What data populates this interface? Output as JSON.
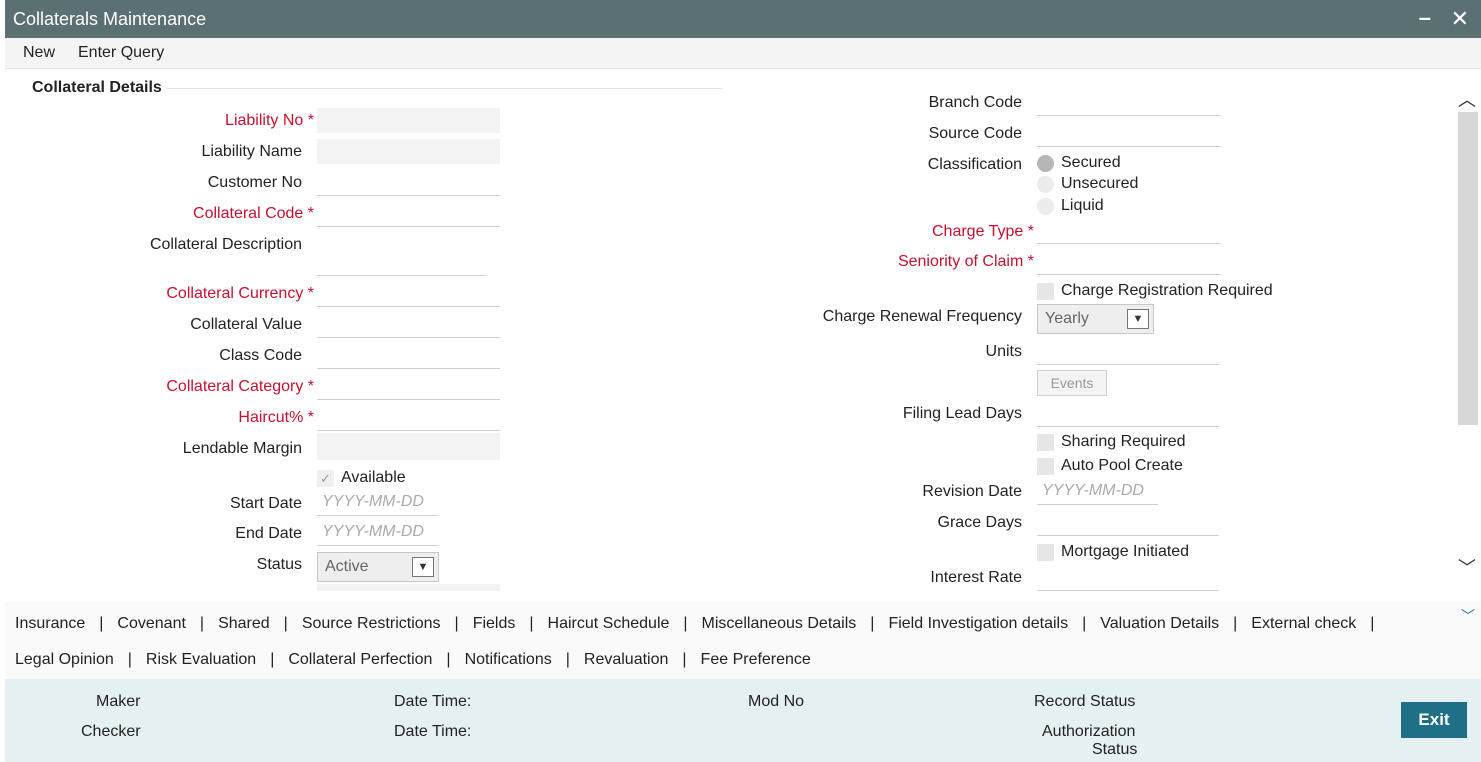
{
  "window": {
    "title": "Collaterals Maintenance",
    "minimize": "–",
    "close": "✕"
  },
  "menu": {
    "new": "New",
    "enter_query": "Enter Query"
  },
  "section": {
    "title": "Collateral Details"
  },
  "left": {
    "liability_no": "Liability No",
    "liability_name": "Liability Name",
    "customer_no": "Customer No",
    "collateral_code": "Collateral Code",
    "collateral_description": "Collateral Description",
    "collateral_currency": "Collateral Currency",
    "collateral_value": "Collateral Value",
    "class_code": "Class Code",
    "collateral_category": "Collateral Category",
    "haircut": "Haircut%",
    "lendable_margin": "Lendable Margin",
    "available": "Available",
    "start_date": "Start Date",
    "start_date_placeholder": "YYYY-MM-DD",
    "end_date": "End Date",
    "end_date_placeholder": "YYYY-MM-DD",
    "status": "Status",
    "status_value": "Active",
    "required_mark": "*"
  },
  "right": {
    "branch_code": "Branch Code",
    "source_code": "Source Code",
    "classification": "Classification",
    "classification_options": [
      "Secured",
      "Unsecured",
      "Liquid"
    ],
    "charge_type": "Charge Type",
    "seniority_of_claim": "Seniority of Claim",
    "charge_registration_required": "Charge Registration Required",
    "charge_renewal_frequency": "Charge Renewal Frequency",
    "charge_renewal_frequency_value": "Yearly",
    "units": "Units",
    "events_button": "Events",
    "filing_lead_days": "Filing Lead Days",
    "sharing_required": "Sharing Required",
    "auto_pool_create": "Auto Pool Create",
    "revision_date": "Revision Date",
    "revision_date_placeholder": "YYYY-MM-DD",
    "grace_days": "Grace Days",
    "mortgage_initiated": "Mortgage Initiated",
    "interest_rate": "Interest Rate",
    "required_mark": "*"
  },
  "tabs": {
    "row1": [
      "Insurance",
      "Covenant",
      "Shared",
      "Source Restrictions",
      "Fields",
      "Haircut Schedule",
      "Miscellaneous Details",
      "Field Investigation details",
      "Valuation Details",
      "External check"
    ],
    "row2": [
      "Legal Opinion",
      "Risk Evaluation",
      "Collateral Perfection",
      "Notifications",
      "Revaluation",
      "Fee Preference"
    ],
    "separator": "|"
  },
  "footer": {
    "maker": "Maker",
    "checker": "Checker",
    "date_time_1": "Date Time:",
    "date_time_2": "Date Time:",
    "mod_no": "Mod No",
    "record_status": "Record Status",
    "authorization_status_line1": "Authorization",
    "authorization_status_line2": "Status",
    "exit": "Exit"
  },
  "colors": {
    "titlebar": "#5b7072",
    "accent": "#1f6f86",
    "required": "#c8102e",
    "footer_bg": "#e4f0f1"
  }
}
